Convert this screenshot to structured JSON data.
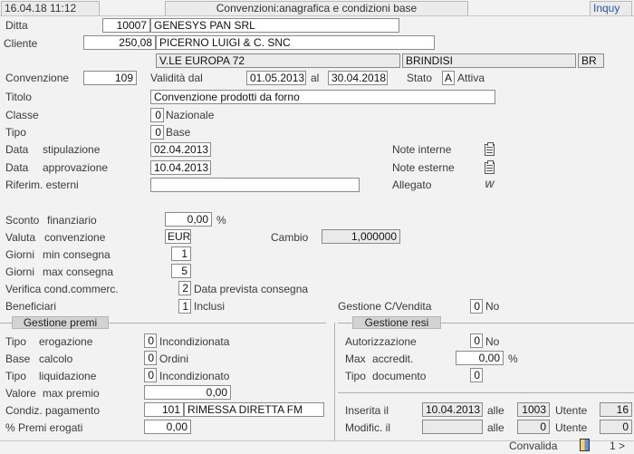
{
  "header": {
    "datetime": "16.04.18 11:12",
    "title": "Convenzioni:anagrafica e condizioni base",
    "mode": "Inquy"
  },
  "ditta": {
    "label": "Ditta",
    "code": "10007",
    "name": "GENESYS PAN SRL"
  },
  "cliente": {
    "label": "Cliente",
    "code": "250,08",
    "name": "PICERNO LUIGI & C. SNC",
    "address": "V.LE EUROPA 72",
    "city": "BRINDISI",
    "province": "BR"
  },
  "convenzione": {
    "label": "Convenzione",
    "number": "109",
    "validita_label": "Validità dal",
    "from": "01.05.2013",
    "al_label": "al",
    "to": "30.04.2018",
    "stato_label": "Stato",
    "stato_code": "A",
    "stato_desc": "Attiva"
  },
  "titolo": {
    "label": "Titolo",
    "value": "Convenzione prodotti da forno"
  },
  "classe": {
    "label": "Classe",
    "code": "0",
    "desc": "Nazionale"
  },
  "tipo": {
    "label": "Tipo",
    "code": "0",
    "desc": "Base"
  },
  "data_stipulazione": {
    "label1": "Data",
    "label2": "stipulazione",
    "value": "02.04.2013"
  },
  "data_approvazione": {
    "label1": "Data",
    "label2": "approvazione",
    "value": "10.04.2013"
  },
  "riferim": {
    "label": "Riferim. esterni",
    "value": ""
  },
  "notes": {
    "interne": "Note interne",
    "esterne": "Note esterne",
    "allegato": "Allegato"
  },
  "sconto": {
    "label1": "Sconto",
    "label2": "finanziario",
    "value": "0,00",
    "unit": "%"
  },
  "valuta": {
    "label1": "Valuta",
    "label2": "convenzione",
    "value": "EUR",
    "cambio_label": "Cambio",
    "cambio": "1,000000"
  },
  "giorni_min": {
    "label1": "Giorni",
    "label2": "min consegna",
    "value": "1"
  },
  "giorni_max": {
    "label1": "Giorni",
    "label2": "max consegna",
    "value": "5"
  },
  "verifica": {
    "label": "Verifica cond.commerc.",
    "code": "2",
    "desc": "Data prevista consegna"
  },
  "beneficiari": {
    "label": "Beneficiari",
    "code": "1",
    "desc": "Inclusi"
  },
  "gestione_cv": {
    "label": "Gestione C/Vendita",
    "code": "0",
    "desc": "No"
  },
  "premi": {
    "title": "Gestione premi",
    "tipo_erogazione": {
      "label1": "Tipo",
      "label2": "erogazione",
      "code": "0",
      "desc": "Incondizionata"
    },
    "base_calcolo": {
      "label1": "Base",
      "label2": "calcolo",
      "code": "0",
      "desc": "Ordini"
    },
    "tipo_liquidazione": {
      "label1": "Tipo",
      "label2": "liquidazione",
      "code": "0",
      "desc": "Incondizionato"
    },
    "valore_max": {
      "label1": "Valore",
      "label2": "max premio",
      "value": "0,00"
    },
    "condiz_pagamento": {
      "label": "Condiz. pagamento",
      "code": "101",
      "desc": "RIMESSA DIRETTA FM"
    },
    "premi_erogati": {
      "label": "% Premi erogati",
      "value": "0,00"
    }
  },
  "resi": {
    "title": "Gestione resi",
    "autorizzazione": {
      "label": "Autorizzazione",
      "code": "0",
      "desc": "No"
    },
    "max_accredit": {
      "label1": "Max",
      "label2": "accredit.",
      "value": "0,00",
      "unit": "%"
    },
    "tipo_documento": {
      "label1": "Tipo",
      "label2": "documento",
      "code": "0"
    }
  },
  "audit": {
    "inserita_label": "Inserita il",
    "inserita_date": "10.04.2013",
    "alle_label": "alle",
    "inserita_time": "1003",
    "utente_label": "Utente",
    "inserita_user": "16",
    "modific_label": "Modific. il",
    "modific_date": "",
    "modific_time": "0",
    "modific_user": "0"
  },
  "footer": {
    "convalida": "Convalida",
    "page": "1 >"
  }
}
